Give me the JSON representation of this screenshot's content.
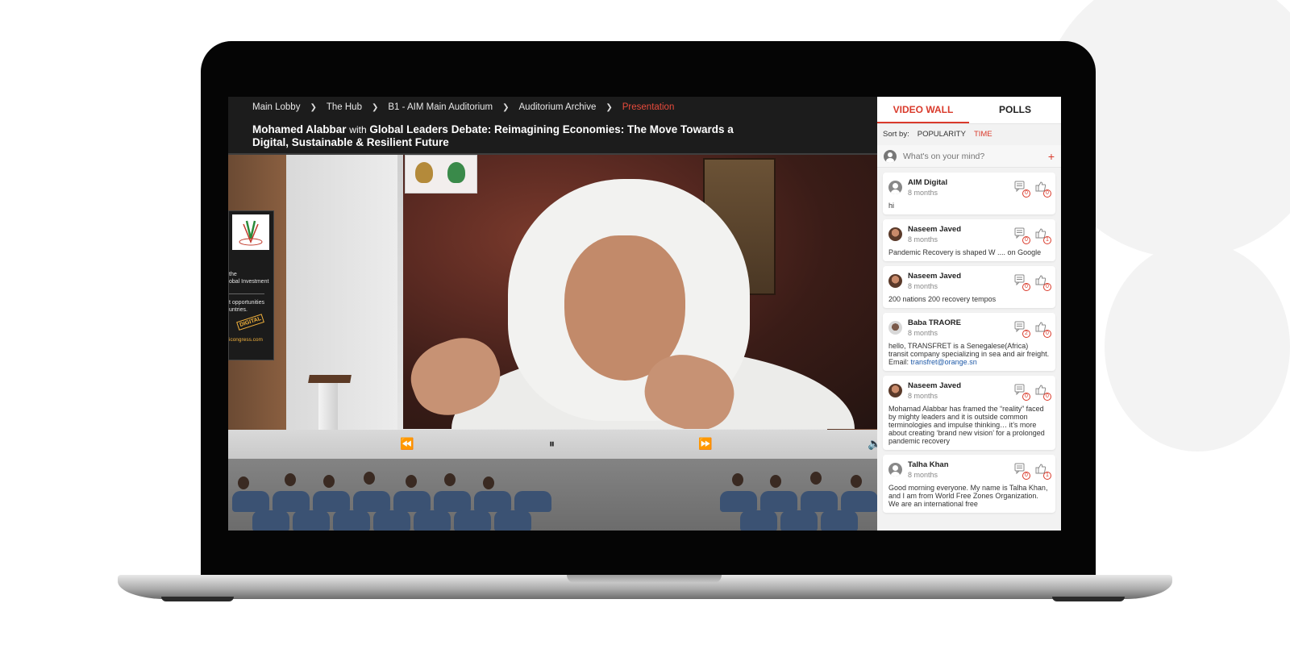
{
  "breadcrumb": [
    "Main Lobby",
    "The Hub",
    "B1 - AIM Main Auditorium",
    "Auditorium Archive",
    "Presentation"
  ],
  "session": {
    "speaker": "Mohamed Alabbar",
    "connector": "with",
    "title": "Global Leaders Debate: Reimagining Economies: The Move Towards a Digital, Sustainable & Resilient Future"
  },
  "banner": {
    "line1": "the",
    "line2": "obal Investment",
    "line3": "t opportunities",
    "line4": "untries.",
    "badge": "DIGITAL",
    "url": "icongress.com"
  },
  "player": {
    "rewind": "⏪",
    "pause": "⏸",
    "forward": "⏩",
    "volume": "🔈"
  },
  "sidebar": {
    "tabs": [
      "VIDEO WALL",
      "POLLS"
    ],
    "active_tab": "VIDEO WALL",
    "sort_label": "Sort by:",
    "sort_options": [
      "POPULARITY",
      "TIME"
    ],
    "active_sort": "TIME",
    "compose_placeholder": "What's on your mind?",
    "compose_plus": "+"
  },
  "posts": [
    {
      "name": "AIM Digital",
      "time": "8 months",
      "text": "hi",
      "comments": "0",
      "likes": "0",
      "avatar": "default"
    },
    {
      "name": "Naseem Javed",
      "time": "8 months",
      "text": "Pandemic Recovery is shaped W .... on Google",
      "comments": "0",
      "likes": "1",
      "avatar": "photo1"
    },
    {
      "name": "Naseem Javed",
      "time": "8 months",
      "text": "200 nations 200 recovery tempos",
      "comments": "0",
      "likes": "0",
      "avatar": "photo1"
    },
    {
      "name": "Baba TRAORE",
      "time": "8 months",
      "text": "hello, TRANSFRET is a Senegalese(Africa) transit company specializing in sea and air freight. Email: ",
      "email": "transfret@orange.sn",
      "comments": "2",
      "likes": "0",
      "avatar": "photo2"
    },
    {
      "name": "Naseem Javed",
      "time": "8 months",
      "text": "Mohamad Alabbar has framed the “reality” faced by mighty leaders and it is outside common terminologies and impulse thinking… it’s more about creating ‘brand new vision’ for a prolonged pandemic recovery",
      "comments": "0",
      "likes": "0",
      "avatar": "photo1"
    },
    {
      "name": "Talha Khan",
      "time": "8 months",
      "text": "Good morning everyone. My name is Talha Khan, and I am from World Free Zones Organization. We are an international free",
      "comments": "0",
      "likes": "1",
      "avatar": "default"
    }
  ],
  "colors": {
    "accent": "#d93a2b",
    "breadcrumb_active": "#e84b3c",
    "link": "#1f5aa8"
  }
}
